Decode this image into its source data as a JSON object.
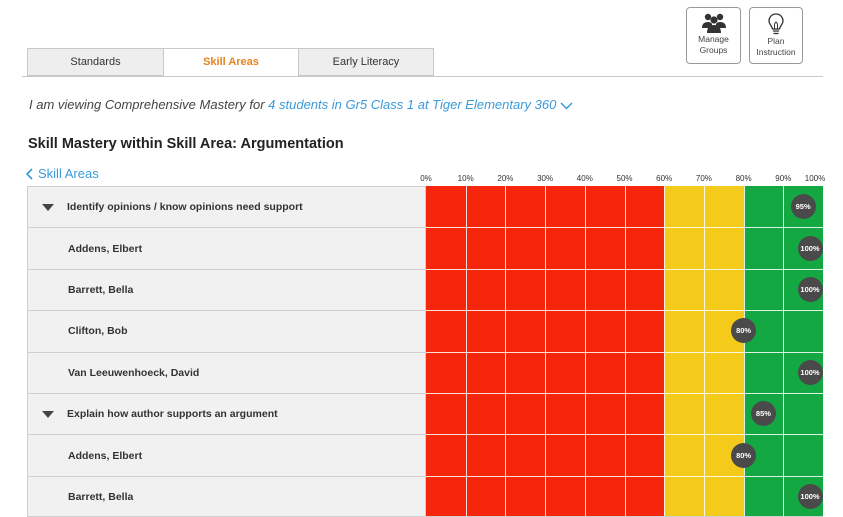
{
  "actions": {
    "manage_groups": "Manage Groups",
    "plan_instruction": "Plan Instruction"
  },
  "tabs": [
    {
      "label": "Standards",
      "active": false
    },
    {
      "label": "Skill Areas",
      "active": true
    },
    {
      "label": "Early Literacy",
      "active": false
    }
  ],
  "viewing": {
    "prefix": "I am viewing Comprehensive Mastery for",
    "link": "4 students in Gr5 Class 1 at Tiger Elementary 360"
  },
  "page_title": "Skill Mastery within Skill Area: Argumentation",
  "back_link": "Skill Areas",
  "axis_ticks": [
    "0%",
    "10%",
    "20%",
    "30%",
    "40%",
    "50%",
    "60%",
    "70%",
    "80%",
    "90%",
    "100%"
  ],
  "colors": {
    "red": "#f5260c",
    "yellow": "#f5cb1b",
    "green": "#13a842",
    "link": "#3a9ad9",
    "active_tab": "#e8821b"
  },
  "thresholds": {
    "red_end": 60,
    "yellow_end": 80
  },
  "rows": [
    {
      "type": "skill",
      "label": "Identify opinions / know opinions need support",
      "value": 95,
      "value_label": "95%"
    },
    {
      "type": "student",
      "label": "Addens, Elbert",
      "value": 100,
      "value_label": "100%"
    },
    {
      "type": "student",
      "label": "Barrett, Bella",
      "value": 100,
      "value_label": "100%"
    },
    {
      "type": "student",
      "label": "Clifton, Bob",
      "value": 80,
      "value_label": "80%"
    },
    {
      "type": "student",
      "label": "Van Leeuwenhoeck, David",
      "value": 100,
      "value_label": "100%"
    },
    {
      "type": "skill",
      "label": "Explain how author supports an argument",
      "value": 85,
      "value_label": "85%"
    },
    {
      "type": "student",
      "label": "Addens, Elbert",
      "value": 80,
      "value_label": "80%"
    },
    {
      "type": "student",
      "label": "Barrett, Bella",
      "value": 100,
      "value_label": "100%"
    }
  ]
}
